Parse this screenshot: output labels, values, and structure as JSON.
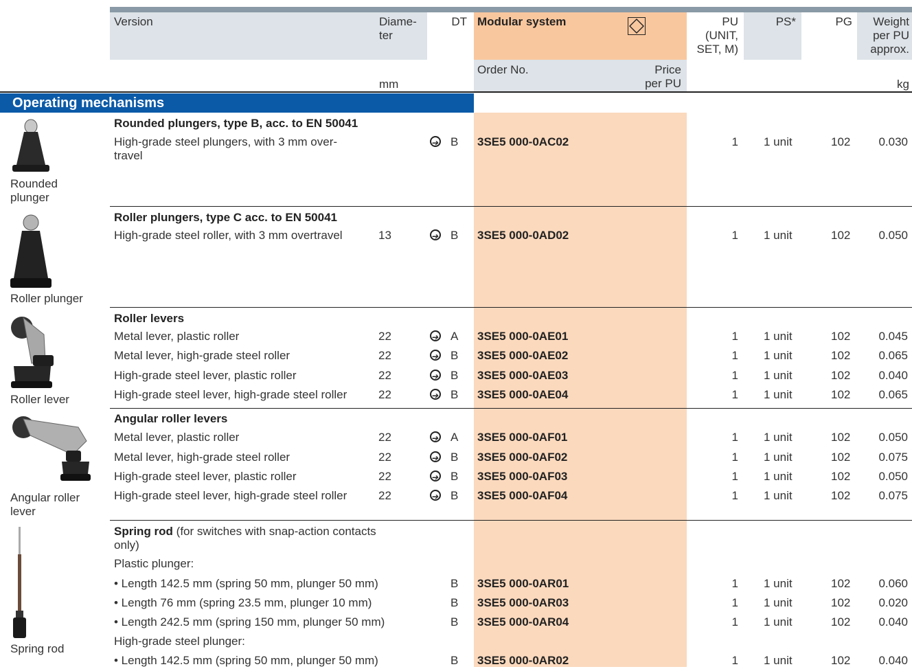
{
  "header": {
    "version": "Version",
    "diameter": "Diame-\nter",
    "dt": "DT",
    "modular": "Modular system",
    "pu": "PU\n(UNIT,\nSET, M)",
    "ps": "PS*",
    "pg": "PG",
    "weight": "Weight\nper PU\napprox.",
    "order_no": "Order No.",
    "price": "Price\nper PU",
    "mm": "mm",
    "kg": "kg"
  },
  "section_title": "Operating mechanisms",
  "captions": {
    "rounded": "Rounded\nplunger",
    "roller_plunger": "Roller plunger",
    "roller_lever": "Roller lever",
    "angular": "Angular roller\nlever",
    "spring": "Spring rod"
  },
  "groups": {
    "g1": {
      "title": "Rounded plungers, type B, acc. to EN 50041"
    },
    "g2": {
      "title": "Roller plungers, type C acc. to EN 50041"
    },
    "g3": {
      "title": "Roller levers"
    },
    "g4": {
      "title": "Angular roller levers"
    },
    "g5": {
      "title": "Spring rod",
      "title_suffix": " (for switches with snap-action contacts",
      "title_line2": "only)",
      "sub1": "Plastic plunger:",
      "sub2": "High-grade steel plunger:"
    }
  },
  "rows": [
    {
      "version": "High-grade steel plungers, with 3 mm over-\ntravel",
      "dia": "",
      "dt": "B",
      "order": "3SE5 000-0AC02",
      "pu": "1",
      "ps": "1 unit",
      "pg": "102",
      "wt": "0.030"
    },
    {
      "version": "High-grade steel roller, with 3 mm overtravel",
      "dia": "13",
      "dt": "B",
      "order": "3SE5 000-0AD02",
      "pu": "1",
      "ps": "1 unit",
      "pg": "102",
      "wt": "0.050"
    },
    {
      "version": "Metal lever, plastic roller",
      "dia": "22",
      "dt": "A",
      "order": "3SE5 000-0AE01",
      "pu": "1",
      "ps": "1 unit",
      "pg": "102",
      "wt": "0.045"
    },
    {
      "version": "Metal lever, high-grade steel roller",
      "dia": "22",
      "dt": "B",
      "order": "3SE5 000-0AE02",
      "pu": "1",
      "ps": "1 unit",
      "pg": "102",
      "wt": "0.065"
    },
    {
      "version": "High-grade steel lever, plastic roller",
      "dia": "22",
      "dt": "B",
      "order": "3SE5 000-0AE03",
      "pu": "1",
      "ps": "1 unit",
      "pg": "102",
      "wt": "0.040"
    },
    {
      "version": "High-grade steel lever, high-grade steel roller",
      "dia": "22",
      "dt": "B",
      "order": "3SE5 000-0AE04",
      "pu": "1",
      "ps": "1 unit",
      "pg": "102",
      "wt": "0.065"
    },
    {
      "version": "Metal lever, plastic roller",
      "dia": "22",
      "dt": "A",
      "order": "3SE5 000-0AF01",
      "pu": "1",
      "ps": "1 unit",
      "pg": "102",
      "wt": "0.050"
    },
    {
      "version": "Metal lever, high-grade steel roller",
      "dia": "22",
      "dt": "B",
      "order": "3SE5 000-0AF02",
      "pu": "1",
      "ps": "1 unit",
      "pg": "102",
      "wt": "0.075"
    },
    {
      "version": "High-grade steel lever, plastic roller",
      "dia": "22",
      "dt": "B",
      "order": "3SE5 000-0AF03",
      "pu": "1",
      "ps": "1 unit",
      "pg": "102",
      "wt": "0.050"
    },
    {
      "version": "High-grade steel lever, high-grade steel roller",
      "dia": "22",
      "dt": "B",
      "order": "3SE5 000-0AF04",
      "pu": "1",
      "ps": "1 unit",
      "pg": "102",
      "wt": "0.075"
    },
    {
      "version": "• Length 142.5 mm (spring 50 mm, plunger 50 mm)",
      "dia": "",
      "dt": "B",
      "order": "3SE5 000-0AR01",
      "pu": "1",
      "ps": "1 unit",
      "pg": "102",
      "wt": "0.060"
    },
    {
      "version": "• Length 76 mm (spring 23.5 mm, plunger 10 mm)",
      "dia": "",
      "dt": "B",
      "order": "3SE5 000-0AR03",
      "pu": "1",
      "ps": "1 unit",
      "pg": "102",
      "wt": "0.020"
    },
    {
      "version": "• Length 242.5 mm (spring 150 mm, plunger 50 mm)",
      "dia": "",
      "dt": "B",
      "order": "3SE5 000-0AR04",
      "pu": "1",
      "ps": "1 unit",
      "pg": "102",
      "wt": "0.040"
    },
    {
      "version": "• Length 142.5 mm (spring 50 mm, plunger 50 mm)",
      "dia": "",
      "dt": "B",
      "order": "3SE5 000-0AR02",
      "pu": "1",
      "ps": "1 unit",
      "pg": "102",
      "wt": "0.040"
    }
  ],
  "colors": {
    "header_bg": "#dde3e8",
    "modular_bg": "#f9c79e",
    "order_bg": "#fbd9bd",
    "section_blue": "#0b5aa8"
  }
}
